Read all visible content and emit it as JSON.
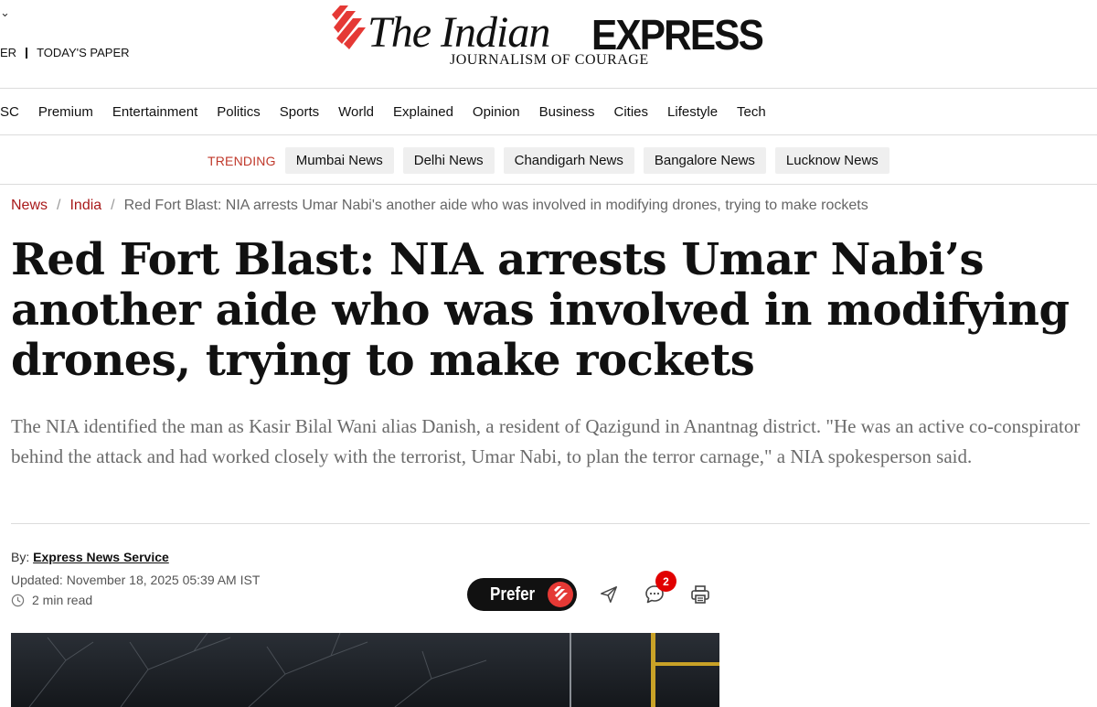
{
  "masthead": {
    "menu_glyph": "⌄",
    "links": [
      "ER",
      "TODAY'S PAPER"
    ],
    "logo": {
      "word_the_indian": "The Indian",
      "word_express": "EXPRESS",
      "tagline": "JOURNALISM OF COURAGE"
    }
  },
  "nav": {
    "items": [
      "SC",
      "Premium",
      "Entertainment",
      "Politics",
      "Sports",
      "World",
      "Explained",
      "Opinion",
      "Business",
      "Cities",
      "Lifestyle",
      "Tech"
    ]
  },
  "trending": {
    "label": "TRENDING",
    "items": [
      "Mumbai News",
      "Delhi News",
      "Chandigarh News",
      "Bangalore News",
      "Lucknow News"
    ]
  },
  "breadcrumb": {
    "items": [
      "News",
      "India"
    ],
    "current": "Red Fort Blast: NIA arrests Umar Nabi's another aide who was involved in modifying drones, trying to make rockets"
  },
  "article": {
    "headline": "Red Fort Blast: NIA arrests Umar Nabi’s another aide who was involved in modifying drones, trying to make rockets",
    "summary": "The NIA identified the man as Kasir Bilal Wani alias Danish, a resident of Qazigund in Anantnag district. \"He was an active co-conspirator behind the attack and had worked closely with the terrorist, Umar Nabi, to plan the terror carnage,\" a NIA spokesperson said.",
    "byline_prefix": "By:",
    "author": "Express News Service",
    "updated": "Updated: November 18, 2025 05:39 AM IST",
    "read_time": "2 min read"
  },
  "actions": {
    "prefer_label": "Prefer",
    "comment_count": "2",
    "icons": [
      "send-icon",
      "comment-icon",
      "print-icon"
    ]
  },
  "colors": {
    "brand_red": "#e53935",
    "link_red": "#a8191a",
    "trending_red": "#c0392b"
  }
}
